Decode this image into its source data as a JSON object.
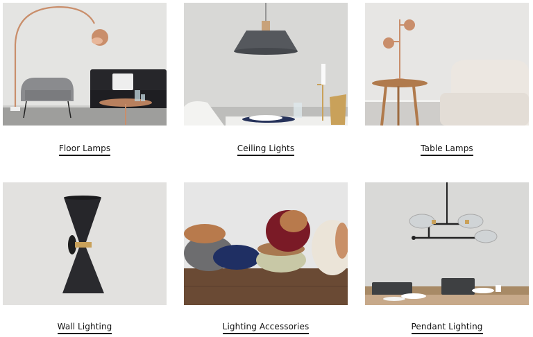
{
  "categories": [
    {
      "label": "Floor Lamps"
    },
    {
      "label": "Ceiling Lights"
    },
    {
      "label": "Table Lamps"
    },
    {
      "label": "Wall Lighting"
    },
    {
      "label": "Lighting Accessories"
    },
    {
      "label": "Pendant Lighting"
    }
  ],
  "colors": {
    "label_text": "#111111",
    "copper": "#c98e6b",
    "background": "#ffffff"
  }
}
